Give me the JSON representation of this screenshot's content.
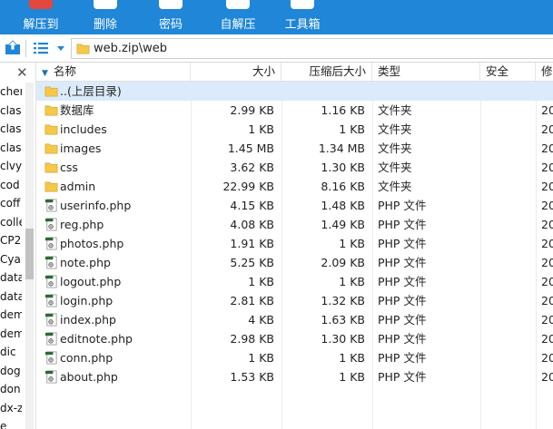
{
  "toolbar": {
    "buttons": [
      {
        "name": "extract-to-button",
        "label": "解压到",
        "color": "#e2483b"
      },
      {
        "name": "delete-button",
        "label": "删除",
        "color": "#ffffff"
      },
      {
        "name": "password-button",
        "label": "密码",
        "color": "#ffffff"
      },
      {
        "name": "self-extract-button",
        "label": "自解压",
        "color": "#ffffff"
      },
      {
        "name": "toolbox-button",
        "label": "工具箱",
        "color": "#ffffff"
      }
    ]
  },
  "address": {
    "path": "web.zip\\web"
  },
  "left_tree": [
    "cher",
    "clas",
    "clas",
    "clas",
    "clvy",
    "cod",
    "coff",
    "colle",
    "CP2",
    "Cyan",
    "data",
    "data",
    "dem",
    "dem",
    "dic",
    "dog",
    "don",
    "dx-z",
    "e"
  ],
  "columns": {
    "name": "名称",
    "size": "大小",
    "compressed": "压缩后大小",
    "type": "类型",
    "security": "安全",
    "modified": "修"
  },
  "files": [
    {
      "name": "..(上层目录)",
      "size": "",
      "compressed": "",
      "type": "",
      "modified": "",
      "kind": "folder",
      "selected": true
    },
    {
      "name": "数据库",
      "size": "2.99 KB",
      "compressed": "1.16 KB",
      "type": "文件夹",
      "modified": "20",
      "kind": "folder"
    },
    {
      "name": "includes",
      "size": "1 KB",
      "compressed": "1 KB",
      "type": "文件夹",
      "modified": "20",
      "kind": "folder"
    },
    {
      "name": "images",
      "size": "1.45 MB",
      "compressed": "1.34 MB",
      "type": "文件夹",
      "modified": "20",
      "kind": "folder"
    },
    {
      "name": "css",
      "size": "3.62 KB",
      "compressed": "1.30 KB",
      "type": "文件夹",
      "modified": "20",
      "kind": "folder"
    },
    {
      "name": "admin",
      "size": "22.99 KB",
      "compressed": "8.16 KB",
      "type": "文件夹",
      "modified": "20",
      "kind": "folder"
    },
    {
      "name": "userinfo.php",
      "size": "4.15 KB",
      "compressed": "1.48 KB",
      "type": "PHP 文件",
      "modified": "20",
      "kind": "php"
    },
    {
      "name": "reg.php",
      "size": "4.08 KB",
      "compressed": "1.49 KB",
      "type": "PHP 文件",
      "modified": "20",
      "kind": "php"
    },
    {
      "name": "photos.php",
      "size": "1.91 KB",
      "compressed": "1 KB",
      "type": "PHP 文件",
      "modified": "20",
      "kind": "php"
    },
    {
      "name": "note.php",
      "size": "5.25 KB",
      "compressed": "2.09 KB",
      "type": "PHP 文件",
      "modified": "20",
      "kind": "php"
    },
    {
      "name": "logout.php",
      "size": "1 KB",
      "compressed": "1 KB",
      "type": "PHP 文件",
      "modified": "20",
      "kind": "php"
    },
    {
      "name": "login.php",
      "size": "2.81 KB",
      "compressed": "1.32 KB",
      "type": "PHP 文件",
      "modified": "20",
      "kind": "php"
    },
    {
      "name": "index.php",
      "size": "4 KB",
      "compressed": "1.63 KB",
      "type": "PHP 文件",
      "modified": "20",
      "kind": "php"
    },
    {
      "name": "editnote.php",
      "size": "2.98 KB",
      "compressed": "1.30 KB",
      "type": "PHP 文件",
      "modified": "20",
      "kind": "php"
    },
    {
      "name": "conn.php",
      "size": "1 KB",
      "compressed": "1 KB",
      "type": "PHP 文件",
      "modified": "20",
      "kind": "php"
    },
    {
      "name": "about.php",
      "size": "1.53 KB",
      "compressed": "1 KB",
      "type": "PHP 文件",
      "modified": "20",
      "kind": "php"
    }
  ],
  "colors": {
    "toolbar": "#1f86d8",
    "selection": "#dcebfb",
    "folder": "#f5c84c",
    "php_icon": "#2e6b2e"
  }
}
